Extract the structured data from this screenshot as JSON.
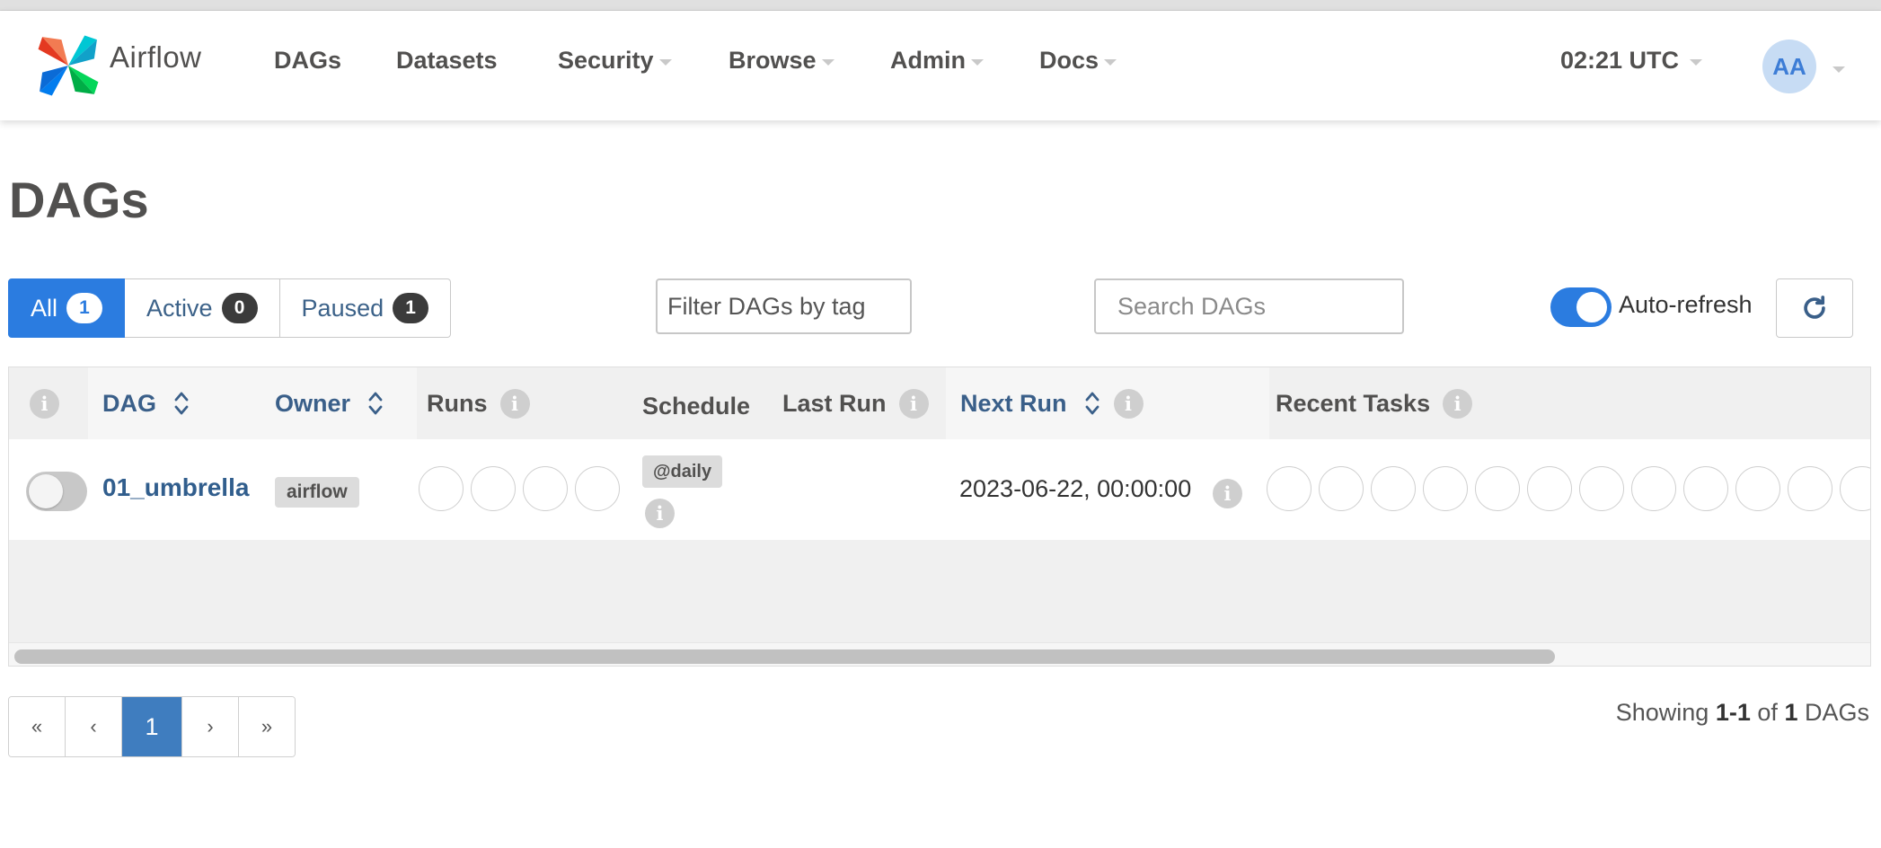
{
  "navbar": {
    "brand": "Airflow",
    "items": [
      {
        "label": "DAGs",
        "dropdown": false
      },
      {
        "label": "Datasets",
        "dropdown": false
      },
      {
        "label": "Security",
        "dropdown": true
      },
      {
        "label": "Browse",
        "dropdown": true
      },
      {
        "label": "Admin",
        "dropdown": true
      },
      {
        "label": "Docs",
        "dropdown": true
      }
    ],
    "time": "02:21 UTC",
    "avatar": "AA"
  },
  "page": {
    "title": "DAGs"
  },
  "filters": {
    "tabs": [
      {
        "label": "All",
        "count": "1",
        "active": true
      },
      {
        "label": "Active",
        "count": "0",
        "active": false
      },
      {
        "label": "Paused",
        "count": "1",
        "active": false
      }
    ],
    "tag_placeholder": "Filter DAGs by tag",
    "search_placeholder": "Search DAGs",
    "auto_refresh_label": "Auto-refresh",
    "auto_refresh_on": true
  },
  "table": {
    "columns": {
      "dag": "DAG",
      "owner": "Owner",
      "runs": "Runs",
      "schedule": "Schedule",
      "last_run": "Last Run",
      "next_run": "Next Run",
      "recent_tasks": "Recent Tasks"
    },
    "rows": [
      {
        "paused": true,
        "dag_id": "01_umbrella",
        "owner": "airflow",
        "schedule": "@daily",
        "last_run": "",
        "next_run": "2023-06-22, 00:00:00"
      }
    ]
  },
  "pagination": {
    "first": "«",
    "prev": "‹",
    "current": "1",
    "next": "›",
    "last": "»"
  },
  "summary": {
    "prefix": "Showing",
    "range": "1-1",
    "of": "of",
    "total": "1",
    "suffix": "DAGs"
  },
  "colors": {
    "primary": "#2b7ce0",
    "link": "#315e8d",
    "page_active": "#3f7dbf"
  }
}
